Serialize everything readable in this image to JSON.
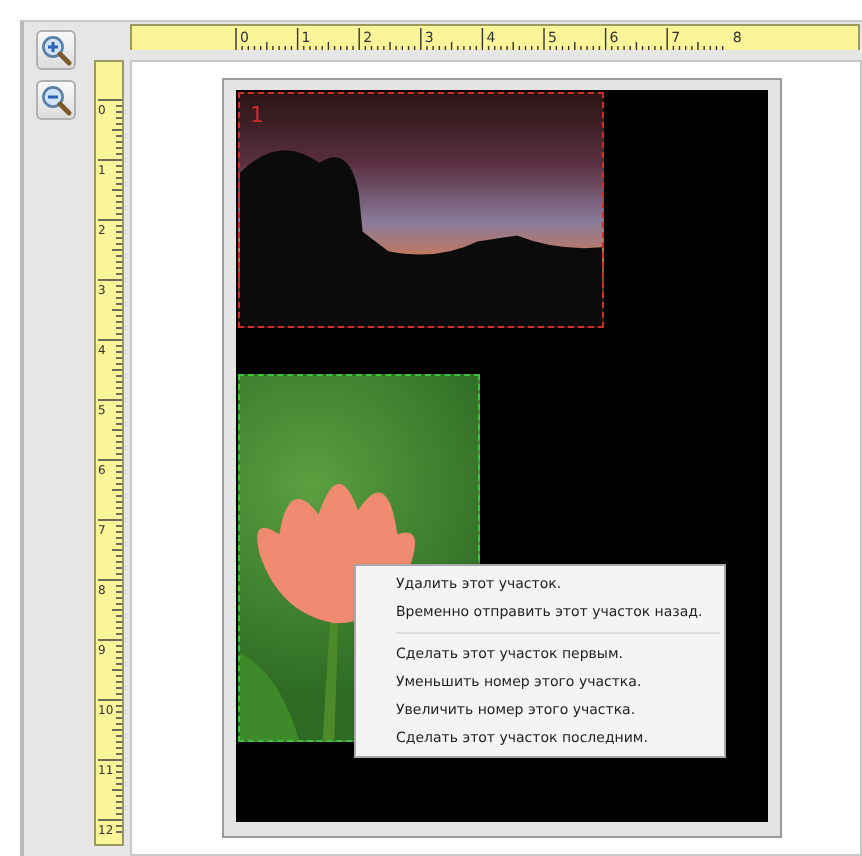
{
  "toolbar": {
    "buttons": [
      {
        "kind": "zoom-in"
      },
      {
        "kind": "zoom-out"
      }
    ]
  },
  "rulers": {
    "horizontal": [
      "0",
      "1",
      "2",
      "3",
      "4",
      "5",
      "6",
      "7",
      "8"
    ],
    "vertical": [
      "0",
      "1",
      "2",
      "3",
      "4",
      "5",
      "6",
      "7",
      "8",
      "9",
      "10",
      "11",
      "12"
    ]
  },
  "regions": [
    {
      "number": "1",
      "color": "#d22a2a",
      "kind": "sunset"
    },
    {
      "color": "#3cc43c",
      "kind": "tulip"
    }
  ],
  "context_menu": [
    {
      "kind": "item",
      "label": "Удалить этот участок."
    },
    {
      "kind": "item",
      "label": "Временно отправить этот участок назад."
    },
    {
      "kind": "separator"
    },
    {
      "kind": "item",
      "label": "Сделать этот участок первым."
    },
    {
      "kind": "item",
      "label": "Уменьшить номер этого участка."
    },
    {
      "kind": "item",
      "label": "Увеличить номер этого участка."
    },
    {
      "kind": "item",
      "label": "Сделать этот участок последним."
    }
  ]
}
